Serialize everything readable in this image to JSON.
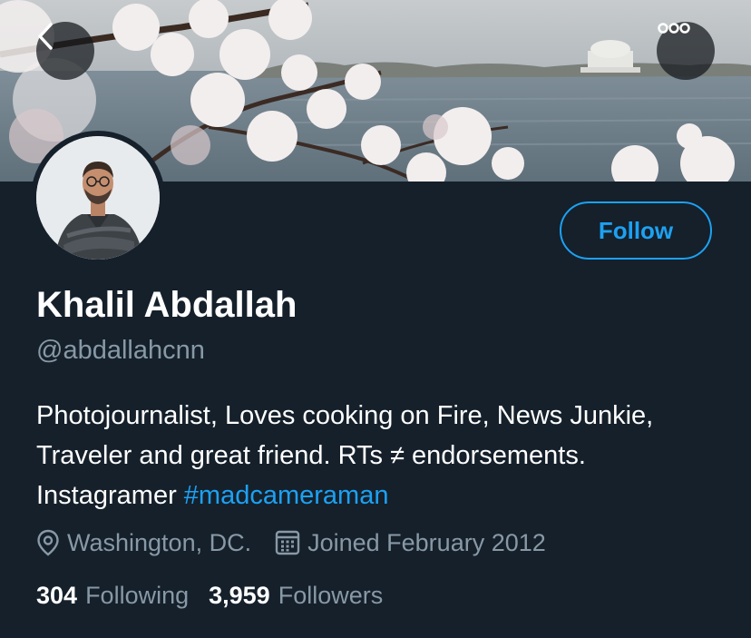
{
  "header": {
    "back_icon": "chevron-left-icon",
    "more_icon": "more-horizontal-icon"
  },
  "profile": {
    "name": "Khalil Abdallah",
    "handle": "@abdallahcnn",
    "bio_text": "Photojournalist, Loves cooking on Fire, News Junkie, Traveler and great friend. RTs ≠ endorsements. Instagramer ",
    "bio_hashtag": "#madcameraman",
    "location": "Washington, DC.",
    "joined": "Joined February 2012"
  },
  "actions": {
    "follow_label": "Follow"
  },
  "stats": {
    "following_count": "304",
    "following_label": "Following",
    "followers_count": "3,959",
    "followers_label": "Followers"
  },
  "colors": {
    "background": "#15202b",
    "accent": "#1da1f2",
    "secondary_text": "#8899a6"
  }
}
